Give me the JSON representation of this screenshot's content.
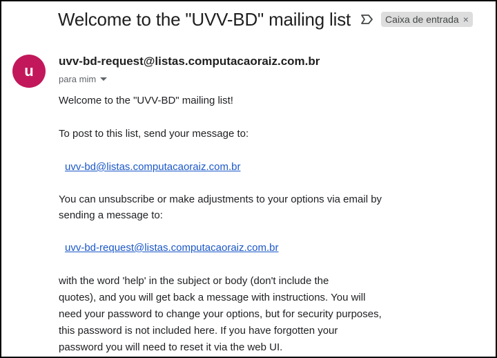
{
  "header": {
    "subject": "Welcome to the \"UVV-BD\" mailing list",
    "label_chip": "Caixa de entrada",
    "label_remove": "×",
    "important_icon": "label-important-outline-icon"
  },
  "message": {
    "avatar_letter": "u",
    "avatar_color": "#c2185b",
    "sender": "uvv-bd-request@listas.computacaoraiz.com.br",
    "to": "para mim",
    "link_color": "#1a57c8",
    "body": {
      "line1": "Welcome to the \"UVV-BD\" mailing list!",
      "line2": "To post to this list, send your message to:",
      "link1": "uvv-bd@listas.computacaoraiz.com.br",
      "line3a": "You can unsubscribe or make adjustments to your options via email by",
      "line3b": "sending a message to:",
      "link2": "uvv-bd-request@listas.computacaoraiz.com.br",
      "line4a": "with the word 'help' in the subject or body (don't include the",
      "line4b": "quotes), and you will get back a message with instructions.  You will",
      "line4c": "need your password to change your options, but for security purposes,",
      "line4d": "this password is not included here.  If you have forgotten your",
      "line4e": "password you will need to reset it via the web UI."
    }
  }
}
